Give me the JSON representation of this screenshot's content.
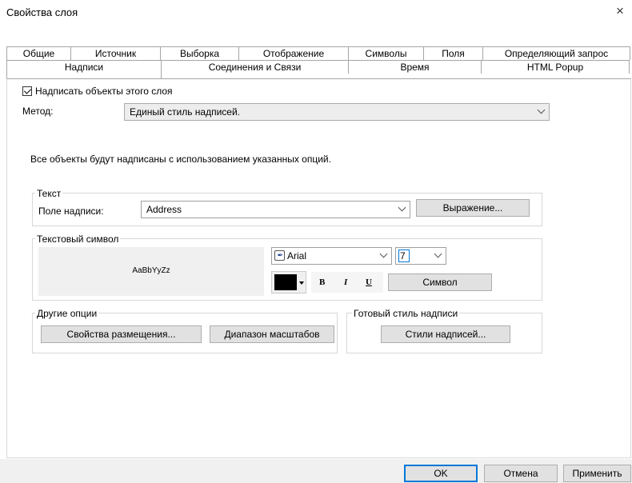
{
  "window": {
    "title": "Свойства слоя",
    "close_glyph": "×"
  },
  "tabs": {
    "row1": [
      "Общие",
      "Источник",
      "Выборка",
      "Отображение",
      "Символы",
      "Поля",
      "Определяющий запрос"
    ],
    "row2": [
      "Надписи",
      "Соединения и Связи",
      "Время",
      "HTML Popup"
    ],
    "active": "Надписи"
  },
  "labels_tab": {
    "label_features_checkbox": "Надписать объекты этого слоя",
    "label_features_checked": true,
    "method_label": "Метод:",
    "method_value": "Единый стиль надписей.",
    "info_text": "Все объекты будут надписаны с использованием указанных опций.",
    "text_group": {
      "title": "Текст",
      "field_label": "Поле надписи:",
      "field_value": "Address",
      "expression_button": "Выражение..."
    },
    "symbol_group": {
      "title": "Текстовый символ",
      "preview_text": "AaBbYyZz",
      "font_icon_glyph": "✒",
      "font_value": "Arial",
      "size_value": "7",
      "color": "#000000",
      "bold_label": "B",
      "italic_label": "I",
      "underline_label": "U",
      "symbol_button": "Символ"
    },
    "other_group": {
      "title": "Другие опции",
      "placement_button": "Свойства размещения...",
      "scale_button": "Диапазон масштабов"
    },
    "style_group": {
      "title": "Готовый стиль надписи",
      "styles_button": "Стили надписей..."
    }
  },
  "footer": {
    "ok": "OK",
    "cancel": "Отмена",
    "apply": "Применить"
  }
}
